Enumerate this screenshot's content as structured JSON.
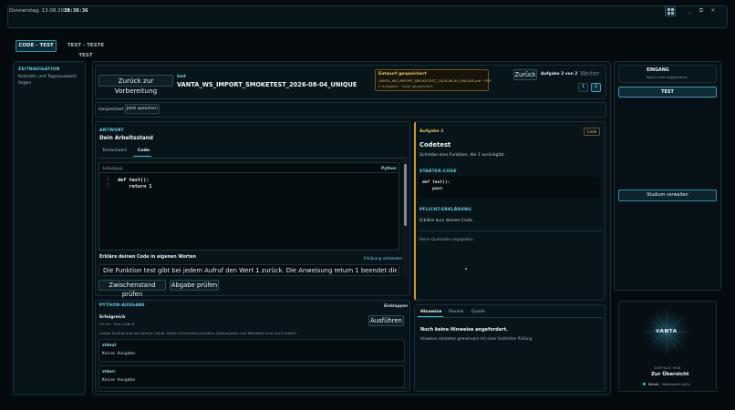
{
  "topbar": {
    "date": "Donnerstag, 13.08.2026",
    "time": "18:38:36",
    "minimize": "_",
    "maximize": "⧉",
    "close": "✕"
  },
  "tabs": [
    {
      "label": "CODE - TEST"
    },
    {
      "label": "TEST - TESTE TEST"
    }
  ],
  "left_sidebar": {
    "title": "ZEITNAVIGATION",
    "line1": "Kalender und Tagesauswahl",
    "line2": "folgen"
  },
  "header": {
    "back_label": "Zurück zur Vorbereitung",
    "kind": "test",
    "title": "VANTA_WS_IMPORT_SMOKETEST_2026-08-04_UNIQUE",
    "draft": {
      "title": "Entwurf gespeichert",
      "file": "VANTA_WS_IMPORT_SMOKETEST_2026-08-04_UNIQUE.pdf · PDF",
      "note": "2 Aufgaben · lokal gespeichert"
    },
    "prev_label": "Zurück",
    "counter": "Aufgabe 2 von 2",
    "next_label": "Weiter",
    "pages": [
      "1",
      "2"
    ]
  },
  "savebar": {
    "status": "Gespeichert",
    "save_now": "Jetzt speichern"
  },
  "answer": {
    "section": "ANTWORT",
    "title": "Dein Arbeitsstand",
    "tabs": [
      "Textantwort",
      "Code"
    ],
    "editor": {
      "filename": "Lösung.py",
      "language": "Python",
      "lines": [
        {
          "no": "1",
          "code": "def test():"
        },
        {
          "no": "2",
          "code": "    return 1"
        }
      ]
    },
    "explain_label": "Erkläre deinen Code in eigenen Worten",
    "explain_status": "Erklärung vorhanden",
    "explain_text": "Die Funktion test gibt bei jedem Aufruf den Wert 1 zurück. Die Anweisung return 1 beendet die Funktion",
    "check_interim": "Zwischenstand prüfen",
    "check_submission": "Abgabe prüfen"
  },
  "python_output": {
    "section": "PYTHON-AUSGABE",
    "collapse": "Einklappen",
    "status": "Erfolgreich",
    "meta": "32 ms · Exit-Code 0",
    "run": "Ausführen",
    "note": "Lokale Ausführung auf deinem Gerät. Keine Sicherheits-Sandbox: Dateisystem und Netzwerk sind nicht isoliert.",
    "stdout_label": "stdout",
    "stdout_value": "Keine Ausgabe",
    "stderr_label": "stderr",
    "stderr_value": "Keine Ausgabe"
  },
  "task": {
    "label": "Aufgabe 2",
    "badge": "Code",
    "title": "Codetest",
    "desc": "Schreibe eine Funktion, die 1 zurückgibt.",
    "starter_label": "STARTER-CODE",
    "starter_lines": [
      "def test():",
      "    pass"
    ],
    "explain_req_label": "PFLICHT-ERKLÄRUNG",
    "explain_req_text": "Erkläre kurz deinen Code.",
    "source_note": "Keine Quellseite angegeben"
  },
  "feedback": {
    "tabs": [
      "Hinweise",
      "Review",
      "Quelle"
    ],
    "title": "Noch keine Hinweise angefordert.",
    "text": "Hinweise entstehen gemeinsam mit einer fachlichen Prüfung."
  },
  "right": {
    "inbox_title": "EINGANG",
    "inbox_sub": "Noch nicht zugeordnet",
    "test_btn": "TEST",
    "manage_btn": "Studium verwalten",
    "hub": {
      "logo": "VANTA",
      "caption": "SURFACE HUB",
      "title": "Zur Übersicht",
      "status": "Bereit",
      "status_detail": "Wakeword aktiv"
    }
  },
  "colors": {
    "accent": "#3fc4e0",
    "success": "#36d39a",
    "warning": "#d2a53b",
    "bg": "#040a0e"
  }
}
